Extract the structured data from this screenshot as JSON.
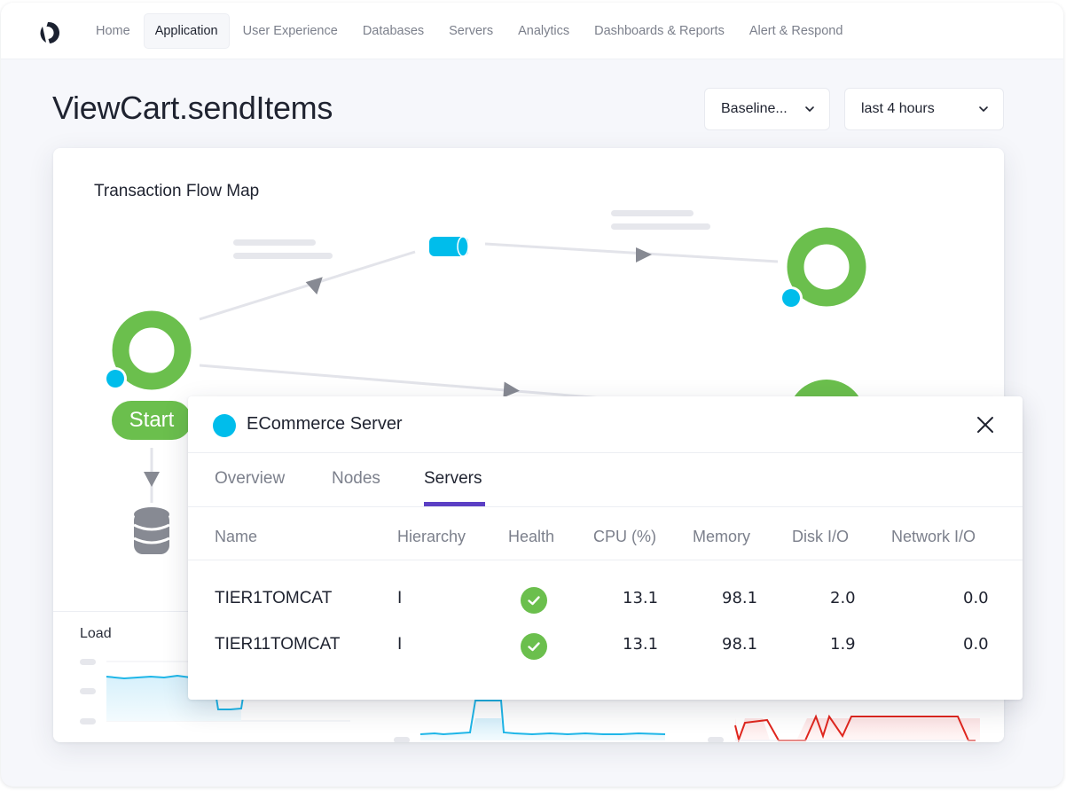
{
  "nav": {
    "logo": "logo-icon",
    "items": [
      {
        "label": "Home",
        "active": false
      },
      {
        "label": "Application",
        "active": true
      },
      {
        "label": "User Experience",
        "active": false
      },
      {
        "label": "Databases",
        "active": false
      },
      {
        "label": "Servers",
        "active": false
      },
      {
        "label": "Analytics",
        "active": false
      },
      {
        "label": "Dashboards & Reports",
        "active": false
      },
      {
        "label": "Alert & Respond",
        "active": false
      }
    ]
  },
  "header": {
    "title": "ViewCart.sendItems",
    "baseline_select": "Baseline...",
    "range_select": "last 4 hours"
  },
  "flow_map": {
    "title": "Transaction Flow Map",
    "start_label": "Start",
    "nodes": [
      {
        "id": "start-app",
        "type": "application",
        "health": "normal"
      },
      {
        "id": "queue",
        "type": "message-queue"
      },
      {
        "id": "app-top-right",
        "type": "application",
        "health": "normal"
      },
      {
        "id": "app-mid-right",
        "type": "application",
        "health": "normal"
      },
      {
        "id": "database",
        "type": "database"
      }
    ],
    "colors": {
      "healthy": "#6bbf4d",
      "tier": "#00bdeb",
      "edge": "#e3e4ea",
      "arrow": "#878a93"
    }
  },
  "charts": {
    "load_label": "Load",
    "colors": {
      "load": "#1eb6e8",
      "response": "#1eb6e8",
      "errors": "#e0261e"
    }
  },
  "panel": {
    "title": "ECommerce Server",
    "tabs": [
      {
        "label": "Overview",
        "active": false
      },
      {
        "label": "Nodes",
        "active": false
      },
      {
        "label": "Servers",
        "active": true
      }
    ],
    "columns": [
      "Name",
      "Hierarchy",
      "Health",
      "CPU (%)",
      "Memory",
      "Disk I/O",
      "Network I/O"
    ],
    "rows": [
      {
        "name": "TIER1TOMCAT",
        "hierarchy": "I",
        "health": "healthy",
        "cpu": "13.1",
        "memory": "98.1",
        "disk_io": "2.0",
        "network_io": "0.0"
      },
      {
        "name": "TIER11TOMCAT",
        "hierarchy": "I",
        "health": "healthy",
        "cpu": "13.1",
        "memory": "98.1",
        "disk_io": "1.9",
        "network_io": "0.0"
      }
    ],
    "accent": "#5b3fc4"
  }
}
